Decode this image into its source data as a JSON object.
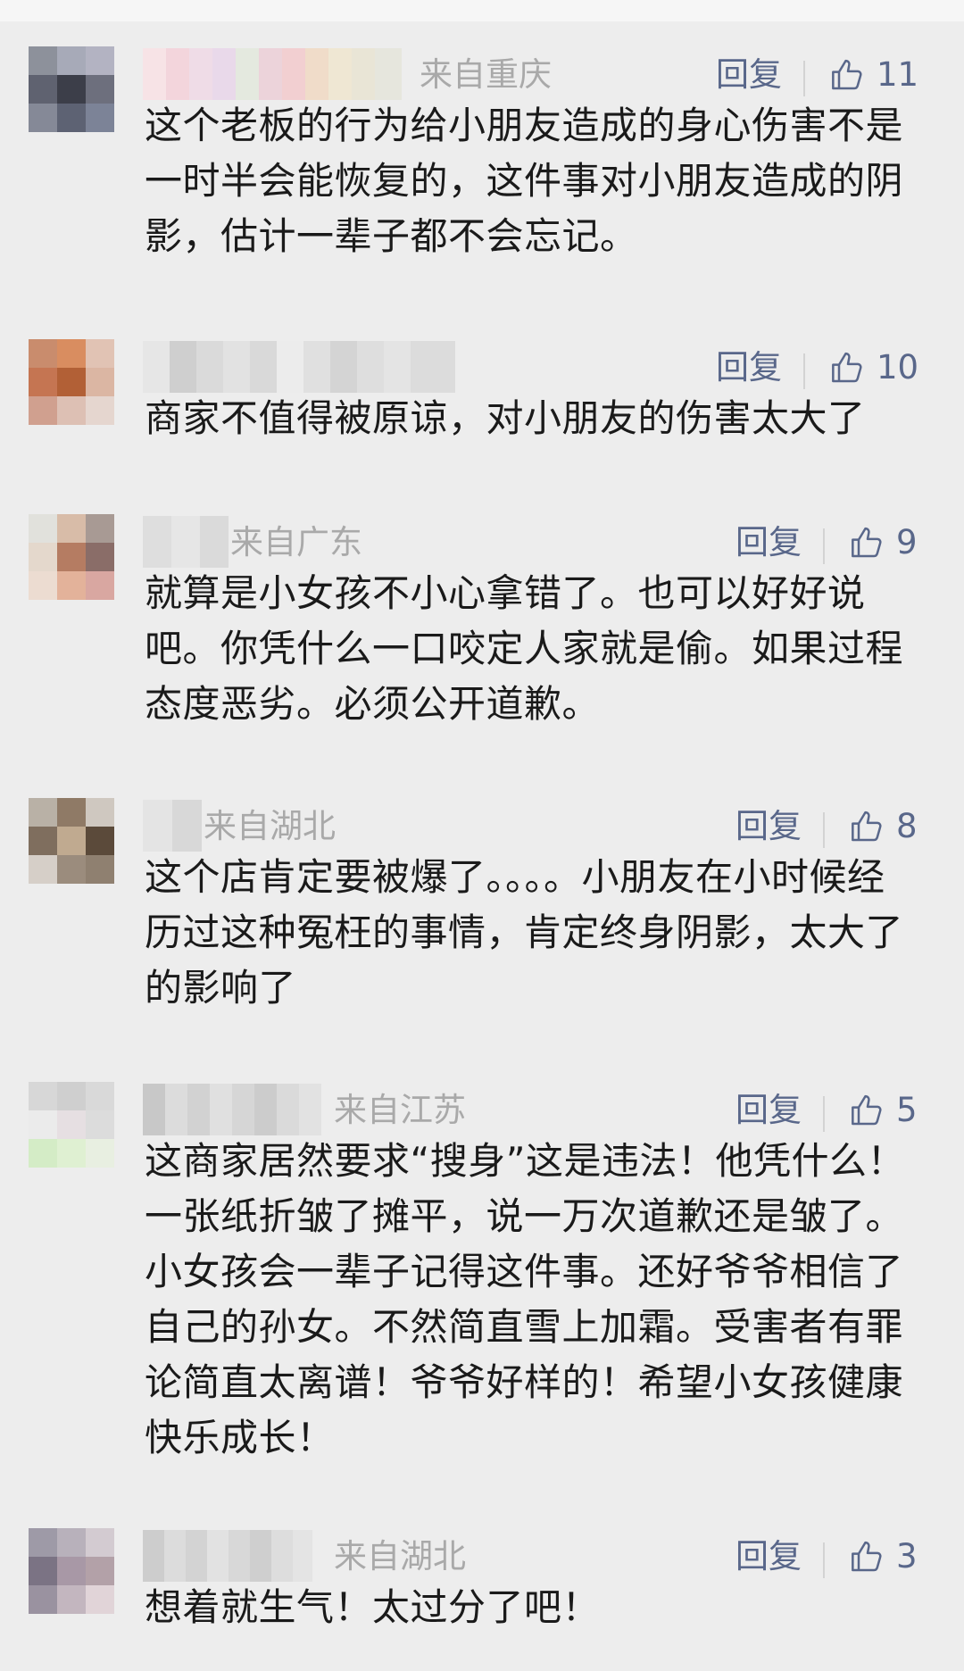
{
  "comments": [
    {
      "location": "来自重庆",
      "reply_label": "回复",
      "likes": "11",
      "text": "这个老板的行为给小朋友造成的身心伤害不是一时半会能恢复的，这件事对小朋友造成的阴影，估计一辈子都不会忘记。"
    },
    {
      "location": "",
      "reply_label": "回复",
      "likes": "10",
      "text": "商家不值得被原谅，对小朋友的伤害太大了"
    },
    {
      "location": "来自广东",
      "reply_label": "回复",
      "likes": "9",
      "text": "就算是小女孩不小心拿错了。也可以好好说吧。你凭什么一口咬定人家就是偷。如果过程态度恶劣。必须公开道歉。"
    },
    {
      "location": "来自湖北",
      "reply_label": "回复",
      "likes": "8",
      "text": "这个店肯定要被爆了。。。。小朋友在小时候经历过这种冤枉的事情，肯定终身阴影，太大了的影响了"
    },
    {
      "location": "来自江苏",
      "reply_label": "回复",
      "likes": "5",
      "text": "这商家居然要求“搜身”这是违法！他凭什么！一张纸折皱了摊平，说一万次道歉还是皱了。小女孩会一辈子记得这件事。还好爷爷相信了自己的孙女。不然简直雪上加霜。受害者有罪论简直太离谱！爷爷好样的！希望小女孩健康快乐成长！"
    },
    {
      "location": "来自湖北",
      "reply_label": "回复",
      "likes": "3",
      "text": "想着就生气！太过分了吧！"
    }
  ],
  "colors": {
    "background": "#ededed",
    "link": "#59678a",
    "location": "#a9a9a9",
    "text": "#1a1a1a"
  },
  "icons": {
    "like": "thumbs-up-icon",
    "avatar": "pixelated-avatar",
    "username": "blurred-username"
  }
}
